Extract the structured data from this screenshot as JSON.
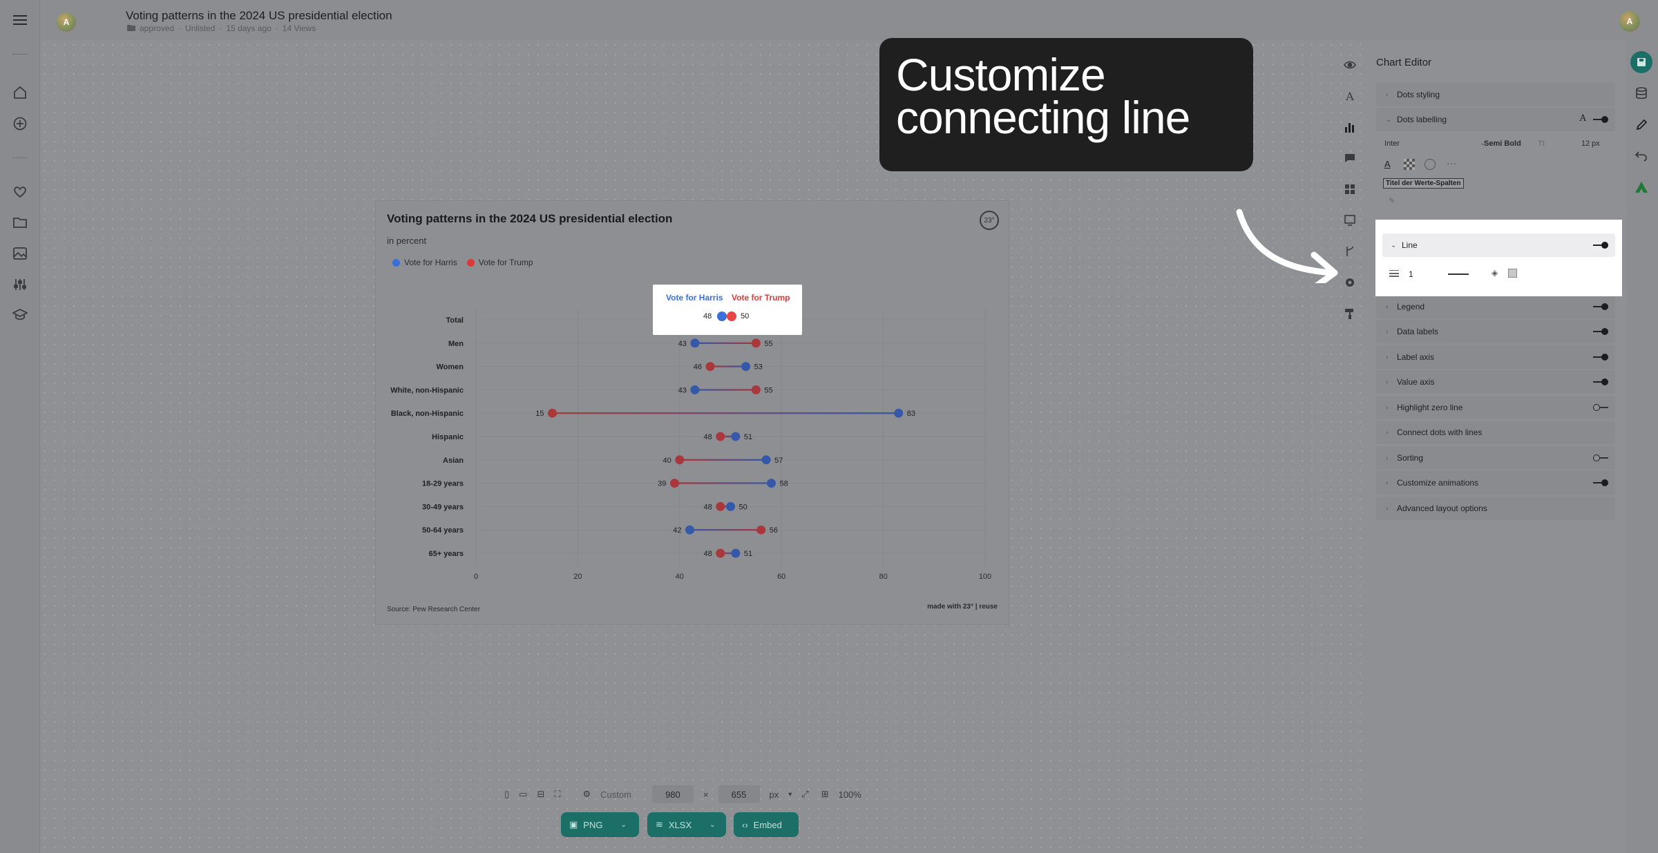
{
  "header": {
    "doc_title": "Voting patterns in the 2024 US presidential election",
    "status": "approved",
    "visibility": "Unlisted",
    "age": "15 days ago",
    "views": "14 Views",
    "avatar_letter": "A"
  },
  "sidebar": {
    "items": [
      "menu-icon",
      "home-icon",
      "add-icon",
      "heart-icon",
      "folder-icon",
      "image-icon",
      "sliders-icon",
      "graduation-icon"
    ]
  },
  "chart_card": {
    "title": "Voting patterns in the 2024 US presidential election",
    "subtitle": "in percent",
    "legend_harris": "Vote for Harris",
    "legend_trump": "Vote for Trump",
    "source": "Source: Pew Research Center",
    "made_with": "made with 23° | reuse",
    "logo_text": "23°"
  },
  "chart_data": {
    "type": "dumbbell",
    "title": "Voting patterns in the 2024 US presidential election",
    "subtitle": "in percent",
    "categories": [
      "Total",
      "Men",
      "Women",
      "White, non-Hispanic",
      "Black, non-Hispanic",
      "Hispanic",
      "Asian",
      "18-29 years",
      "30-49 years",
      "50-64 years",
      "65+ years"
    ],
    "series": [
      {
        "name": "Vote for Harris",
        "color": "#3a6fd8",
        "values": [
          48,
          43,
          53,
          43,
          83,
          51,
          57,
          58,
          50,
          42,
          51
        ]
      },
      {
        "name": "Vote for Trump",
        "color": "#d93a3a",
        "values": [
          50,
          55,
          46,
          55,
          15,
          48,
          40,
          39,
          48,
          56,
          48
        ]
      }
    ],
    "x_ticks": [
      0,
      20,
      40,
      60,
      80,
      100
    ],
    "xlim": [
      0,
      100
    ],
    "grid": true,
    "legend": "top-left"
  },
  "highlight": {
    "harris": "Vote for Harris",
    "trump": "Vote for Trump",
    "harris_val": "48",
    "trump_val": "50"
  },
  "tooltip": {
    "text": "Customize connecting line"
  },
  "editor": {
    "title": "Chart Editor",
    "sections": {
      "dots_styling": "Dots styling",
      "dots_labelling": "Dots labelling",
      "font": "Inter",
      "weight": "Semi Bold",
      "size": "12",
      "unit": "px",
      "column_title": "Titel der Werte-Spalten",
      "line": "Line",
      "line_width": "1",
      "legend": "Legend",
      "data_labels": "Data labels",
      "label_axis": "Label axis",
      "value_axis": "Value axis",
      "highlight_zero": "Highlight zero line",
      "connect_dots": "Connect dots with lines",
      "sorting": "Sorting",
      "animations": "Customize animations",
      "advanced": "Advanced layout options"
    }
  },
  "bottom": {
    "preset": "Custom",
    "width": "980",
    "times": "×",
    "height": "655",
    "unit": "px",
    "zoom": "100%",
    "png": "PNG",
    "xlsx": "XLSX",
    "embed": "Embed"
  },
  "colors": {
    "harris": "#3a6fd8",
    "trump": "#d93a3a",
    "accent": "#1b6f66",
    "tooltip_bg": "#1f1f1f"
  }
}
